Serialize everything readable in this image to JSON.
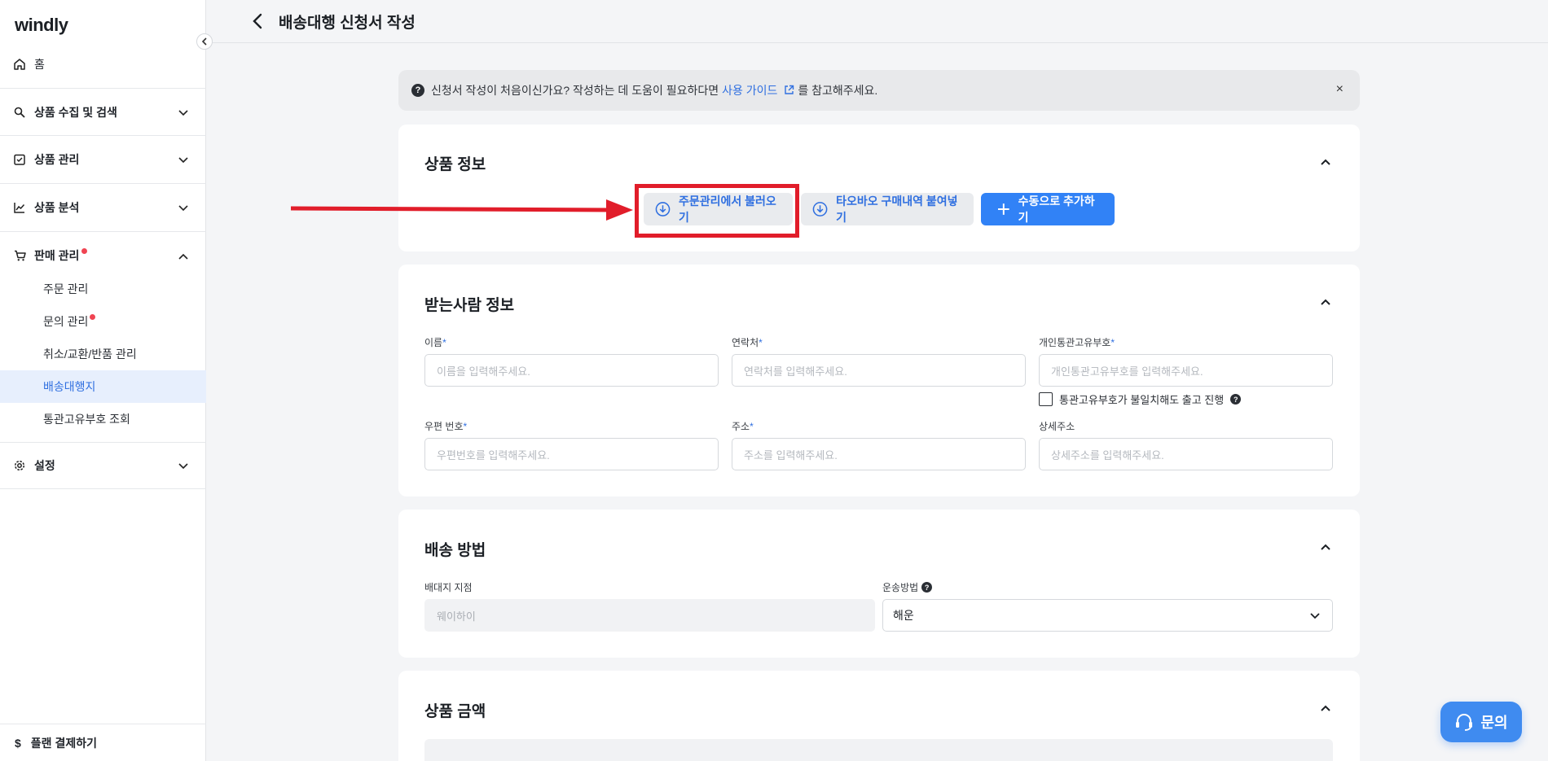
{
  "sidebar": {
    "logo": "windly",
    "home": "홈",
    "sections": [
      {
        "label": "상품 수집 및 검색",
        "icon": "search-icon"
      },
      {
        "label": "상품 관리",
        "icon": "checklist-icon"
      },
      {
        "label": "상품 분석",
        "icon": "chart-icon"
      },
      {
        "label": "판매 관리",
        "icon": "cart-icon"
      },
      {
        "label": "설정",
        "icon": "gear-icon"
      }
    ],
    "sales_items": [
      "주문 관리",
      "문의 관리",
      "취소/교환/반품 관리",
      "배송대행지",
      "통관고유부호 조회"
    ],
    "active_item": "배송대행지",
    "bottom": "플랜 결제하기"
  },
  "header": {
    "title": "배송대행 신청서 작성"
  },
  "notice": {
    "text_before": "신청서 작성이 처음이신가요? 작성하는 데 도움이 필요하다면",
    "link": "사용 가이드",
    "text_after": "를 참고해주세요.",
    "close": "×"
  },
  "product_info": {
    "title": "상품 정보",
    "btn_order_import": "주문관리에서 불러오기",
    "btn_taobao": "타오바오 구매내역 붙여넣기",
    "btn_manual": "수동으로 추가하기"
  },
  "recipient": {
    "title": "받는사람 정보",
    "name_label": "이름",
    "name_placeholder": "이름을 입력해주세요.",
    "phone_label": "연락처",
    "phone_placeholder": "연락처를 입력해주세요.",
    "customs_label": "개인통관고유부호",
    "customs_placeholder": "개인통관고유부호를 입력해주세요.",
    "mismatch_checkbox": "통관고유부호가 불일치해도 출고 진행",
    "zip_label": "우편 번호",
    "zip_placeholder": "우편번호를 입력해주세요.",
    "address_label": "주소",
    "address_placeholder": "주소를 입력해주세요.",
    "detail_label": "상세주소",
    "detail_placeholder": "상세주소를 입력해주세요.",
    "required_mark": "*"
  },
  "shipping": {
    "title": "배송 방법",
    "branch_label": "배대지 지점",
    "branch_value": "웨이하이",
    "method_label": "운송방법",
    "method_value": "해운"
  },
  "amount": {
    "title": "상품 금액"
  },
  "inquiry_button": "문의",
  "colors": {
    "accent": "#3182f6",
    "highlight": "#e11d2a",
    "alert_dot": "#f04452"
  }
}
